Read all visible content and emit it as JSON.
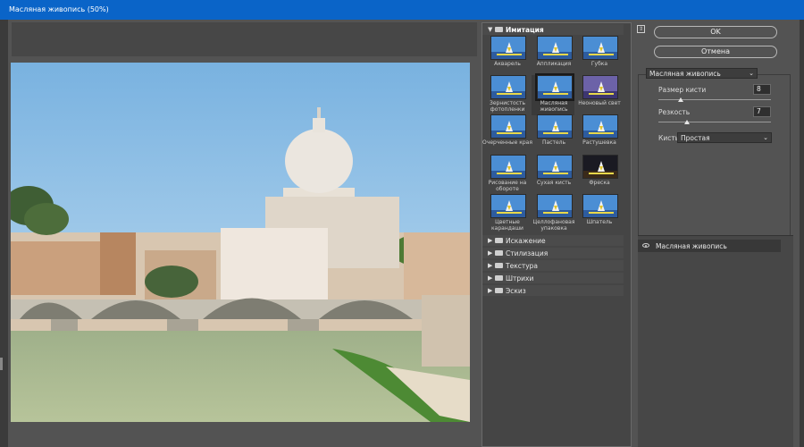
{
  "window": {
    "title": "Масляная живопись (50%)"
  },
  "gallery": {
    "categories": [
      {
        "label": "Имитация",
        "expanded": true
      },
      {
        "label": "Искажение",
        "expanded": false
      },
      {
        "label": "Стилизация",
        "expanded": false
      },
      {
        "label": "Текстура",
        "expanded": false
      },
      {
        "label": "Штрихи",
        "expanded": false
      },
      {
        "label": "Эскиз",
        "expanded": false
      }
    ],
    "filters": [
      {
        "label": "Акварель",
        "style": "normal"
      },
      {
        "label": "Аппликация",
        "style": "normal"
      },
      {
        "label": "Губка",
        "style": "normal"
      },
      {
        "label": "Зернистость фотопленки",
        "style": "normal"
      },
      {
        "label": "Масляная живопись",
        "style": "normal",
        "selected": true
      },
      {
        "label": "Неоновый свет",
        "style": "purple"
      },
      {
        "label": "Очерченные края",
        "style": "normal"
      },
      {
        "label": "Пастель",
        "style": "normal"
      },
      {
        "label": "Растушевка",
        "style": "normal"
      },
      {
        "label": "Рисование на обороте",
        "style": "normal"
      },
      {
        "label": "Сухая кисть",
        "style": "normal"
      },
      {
        "label": "Фреска",
        "style": "dark"
      },
      {
        "label": "Цветные карандаши",
        "style": "normal"
      },
      {
        "label": "Целлофановая упаковка",
        "style": "normal"
      },
      {
        "label": "Шпатель",
        "style": "normal"
      }
    ]
  },
  "buttons": {
    "ok": "OK",
    "cancel": "Отмена",
    "collapse": "⇕"
  },
  "settings": {
    "filter_select": "Масляная живопись",
    "brush_size_label": "Размер кисти",
    "brush_size_value": "8",
    "brush_size_level": 0.2,
    "sharpness_label": "Резкость",
    "sharpness_value": "7",
    "sharpness_level": 0.25,
    "brush_type_label": "Кисть:",
    "brush_type_value": "Простая"
  },
  "layers": [
    {
      "label": "Масляная живопись"
    }
  ],
  "colors": {
    "titlebar": "#0a64c8",
    "panel": "#535353",
    "sky": "#7fb5de"
  }
}
